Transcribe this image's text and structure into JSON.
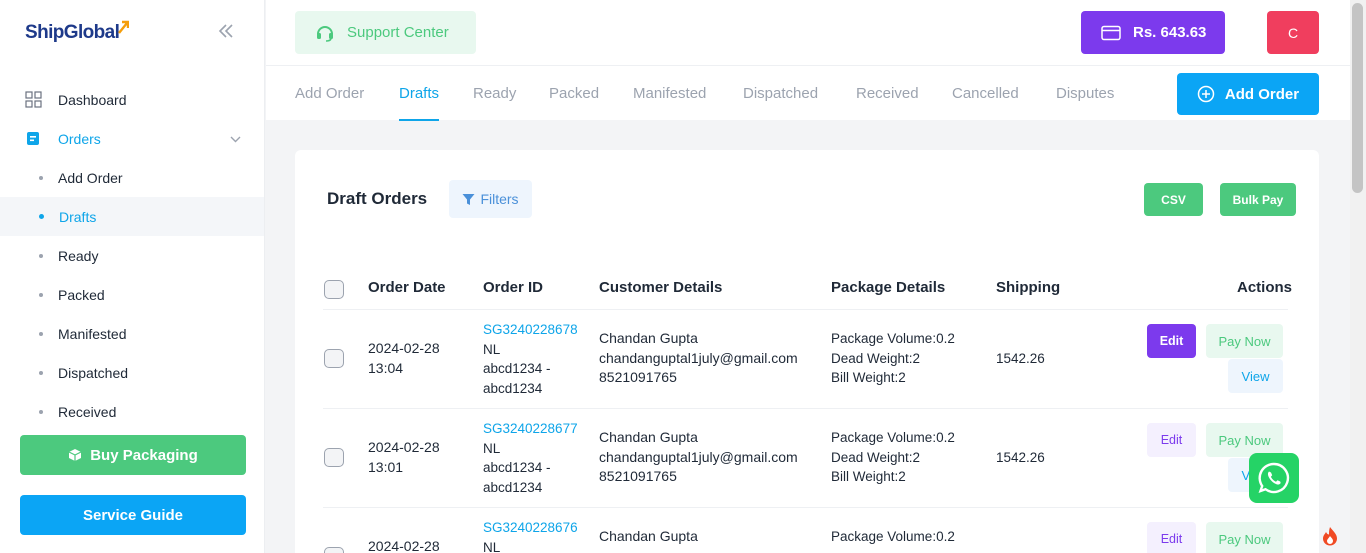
{
  "brand": {
    "name": "ShipGlobal"
  },
  "sidebar": {
    "collapse_icon": "double-chevron-left-icon",
    "items": [
      {
        "label": "Dashboard",
        "icon": "grid-icon"
      },
      {
        "label": "Orders",
        "icon": "clipboard-icon"
      }
    ],
    "sub_items": [
      {
        "label": "Add Order"
      },
      {
        "label": "Drafts"
      },
      {
        "label": "Ready"
      },
      {
        "label": "Packed"
      },
      {
        "label": "Manifested"
      },
      {
        "label": "Dispatched"
      },
      {
        "label": "Received"
      }
    ],
    "buy_packaging": "Buy Packaging",
    "service_guide": "Service Guide"
  },
  "topbar": {
    "support_label": "Support Center",
    "wallet_balance": "Rs. 643.63",
    "avatar_initial": "C"
  },
  "tabs": [
    "Add Order",
    "Drafts",
    "Ready",
    "Packed",
    "Manifested",
    "Dispatched",
    "Received",
    "Cancelled",
    "Disputes"
  ],
  "add_order_label": "Add Order",
  "card": {
    "title": "Draft Orders",
    "filters_label": "Filters",
    "csv_label": "CSV",
    "bulk_pay_label": "Bulk Pay"
  },
  "table": {
    "headers": [
      "Order Date",
      "Order ID",
      "Customer Details",
      "Package Details",
      "Shipping",
      "Actions"
    ],
    "rows": [
      {
        "date": "2024-02-28",
        "time": "13:04",
        "order_id": "SG3240228678",
        "nl": "NL",
        "ref1": "abcd1234 -",
        "ref2": "abcd1234",
        "customer_name": "Chandan Gupta",
        "customer_email": "chandanguptal1july@gmail.com",
        "customer_phone": "8521091765",
        "pkg_volume": "Package Volume:0.2",
        "pkg_dead": "Dead Weight:2",
        "pkg_bill": "Bill Weight:2",
        "shipping": "1542.26",
        "edit": "Edit",
        "pay": "Pay Now",
        "view": "View"
      },
      {
        "date": "2024-02-28",
        "time": "13:01",
        "order_id": "SG3240228677",
        "nl": "NL",
        "ref1": "abcd1234 -",
        "ref2": "abcd1234",
        "customer_name": "Chandan Gupta",
        "customer_email": "chandanguptal1july@gmail.com",
        "customer_phone": "8521091765",
        "pkg_volume": "Package Volume:0.2",
        "pkg_dead": "Dead Weight:2",
        "pkg_bill": "Bill Weight:2",
        "shipping": "1542.26",
        "edit": "Edit",
        "pay": "Pay Now",
        "view": "View"
      },
      {
        "date": "2024-02-28",
        "order_id": "SG3240228676",
        "nl": "NL",
        "customer_name": "Chandan Gupta",
        "pkg_volume": "Package Volume:0.2",
        "edit": "Edit",
        "pay": "Pay Now"
      }
    ]
  },
  "colors": {
    "accent": "#0ea5e9",
    "green": "#4cc97e",
    "purple": "#7c3aed",
    "red": "#f03e5e"
  }
}
